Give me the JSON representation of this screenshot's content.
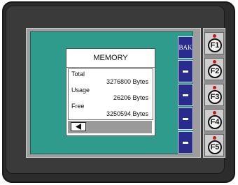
{
  "window": {
    "title": "MEMORY",
    "rows": [
      {
        "label": "Total",
        "value": "3276800 Bytes"
      },
      {
        "label": "Usage",
        "value": "26206 Bytes"
      },
      {
        "label": "Free",
        "value": "3250594 Bytes"
      }
    ],
    "back_icon": "left-arrow-icon"
  },
  "side_buttons": [
    {
      "label": "BAK"
    },
    {
      "label": "-"
    },
    {
      "label": "-"
    },
    {
      "label": "-"
    },
    {
      "label": "-"
    }
  ],
  "function_keys": [
    {
      "label": "F1"
    },
    {
      "label": "F2"
    },
    {
      "label": "F3"
    },
    {
      "label": "F4"
    },
    {
      "label": "F5"
    }
  ],
  "colors": {
    "screen": "#2f9b8c",
    "side_button": "#2a2b8f",
    "led": "#c41a1a",
    "bezel": "#2c2c2c"
  }
}
